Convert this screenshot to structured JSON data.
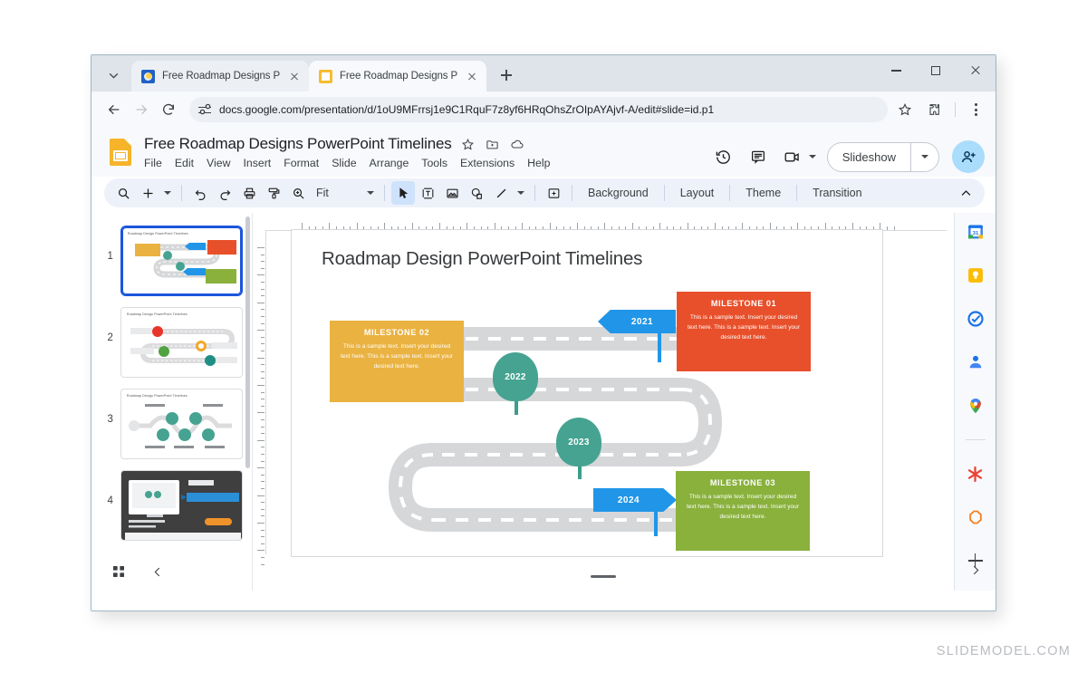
{
  "browser": {
    "tabs": [
      {
        "title": "Free Roadmap Designs PowerPo",
        "favicon": "generic-blue-icon",
        "active": false
      },
      {
        "title": "Free Roadmap Designs PowerPo",
        "favicon": "google-slides-icon",
        "active": true
      }
    ],
    "new_tab_label": "+",
    "url": "docs.google.com/presentation/d/1oU9MFrrsj1e9C1RquF7z8yf6HRqOhsZrOIpAYAjvf-A/edit#slide=id.p1",
    "window_controls": {
      "minimize": "minimize-icon",
      "maximize": "maximize-icon",
      "close": "close-icon"
    }
  },
  "docs": {
    "title": "Free Roadmap Designs PowerPoint Timelines",
    "menus": [
      "File",
      "Edit",
      "View",
      "Insert",
      "Format",
      "Slide",
      "Arrange",
      "Tools",
      "Extensions",
      "Help"
    ],
    "title_actions": [
      "star-icon",
      "move-to-folder-icon",
      "cloud-saved-icon"
    ],
    "header_actions": [
      "version-history-icon",
      "comment-icon",
      "meet-camera-icon"
    ],
    "slideshow_label": "Slideshow",
    "share_label": "add-person-icon"
  },
  "toolbar": {
    "zoom_value": "Fit",
    "items": [
      "search-icon",
      "add-slide-icon",
      "undo-icon",
      "redo-icon",
      "print-icon",
      "paint-format-icon",
      "zoom-icon",
      "select-tool-icon",
      "text-box-icon",
      "insert-image-icon",
      "shape-icon",
      "line-icon",
      "comment-add-icon"
    ],
    "text_buttons": [
      "Background",
      "Layout",
      "Theme",
      "Transition"
    ],
    "collapse_label": "collapse-toolbar-icon"
  },
  "filmstrip": {
    "slides": [
      {
        "number": "1",
        "caption": "Roadmap Design PowerPoint Timelines",
        "active": true
      },
      {
        "number": "2",
        "caption": "Roadmap Design PowerPoint Timelines",
        "active": false
      },
      {
        "number": "3",
        "caption": "Roadmap Design PowerPoint Timelines",
        "active": false
      },
      {
        "number": "4",
        "caption": "",
        "active": false
      }
    ],
    "footer": [
      "grid-view-icon",
      "collapse-filmstrip-icon"
    ]
  },
  "side_panel": {
    "items": [
      "google-calendar-icon",
      "google-keep-icon",
      "google-tasks-icon",
      "google-contacts-icon",
      "google-maps-icon",
      "addon-red-asterisk-icon",
      "addon-orange-icon",
      "add-addon-icon",
      "expand-panel-icon"
    ]
  },
  "slide": {
    "title": "Roadmap Design PowerPoint Timelines",
    "years": [
      "2021",
      "2022",
      "2023",
      "2024"
    ],
    "milestones": [
      {
        "id": "01",
        "heading": "MILESTONE 01",
        "body": "This is a sample text. Insert your desired text here. This is a sample text. Insert your desired text here.",
        "color": "#e8502b"
      },
      {
        "id": "02",
        "heading": "MILESTONE 02",
        "body": "This is a sample text. Insert your desired text here. This is a sample text. Insert your desired text here.",
        "color": "#eab240"
      },
      {
        "id": "03",
        "heading": "MILESTONE 03",
        "body": "This is a sample text. Insert your desired text here. This is a sample text. Insert your desired text here.",
        "color": "#89b13c"
      }
    ],
    "sign_color": "#2196e8",
    "pin_color": "#46a391",
    "road_color": "#d6d7d9"
  },
  "watermark": "SLIDEMODEL.COM"
}
